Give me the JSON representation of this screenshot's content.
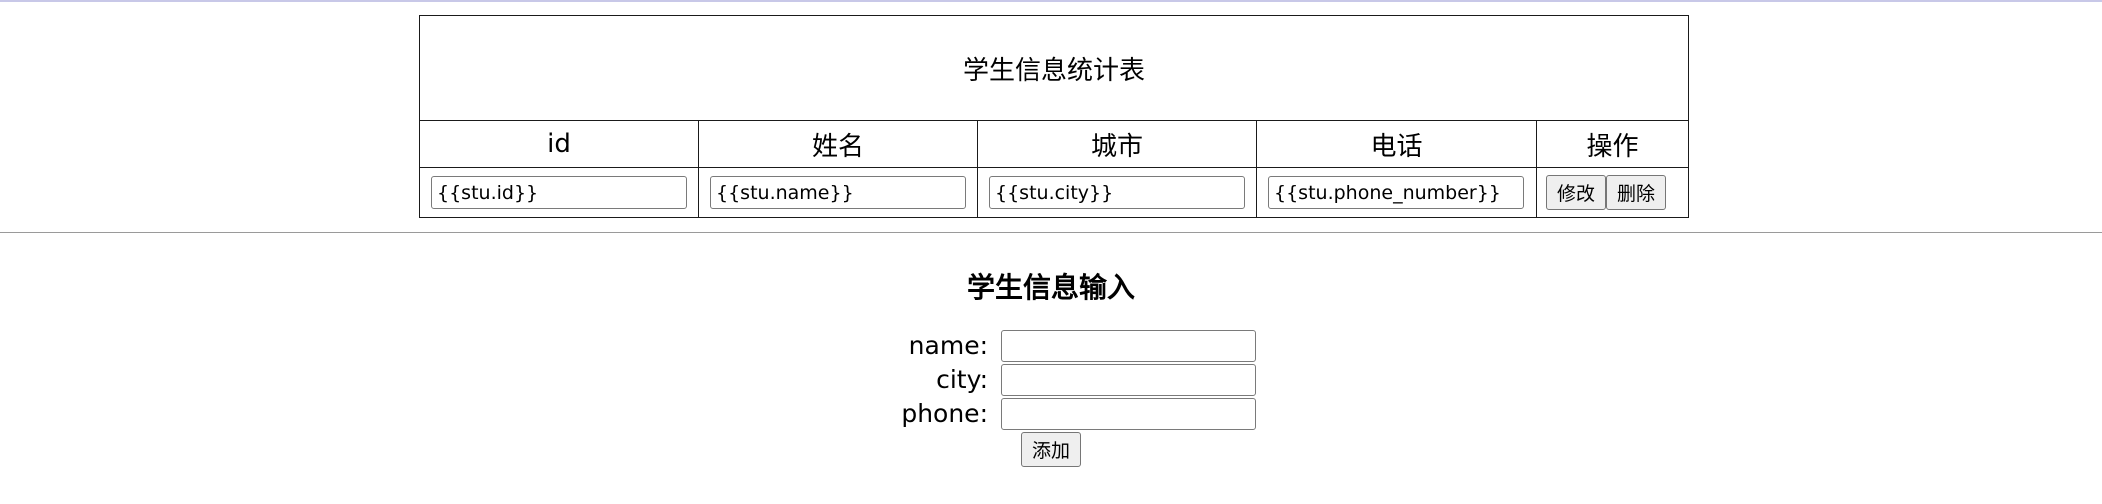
{
  "table": {
    "caption": "学生信息统计表",
    "headers": {
      "id": "id",
      "name": "姓名",
      "city": "城市",
      "phone": "电话",
      "ops": "操作"
    },
    "row": {
      "id_value": "{{stu.id}}",
      "name_value": "{{stu.name}}",
      "city_value": "{{stu.city}}",
      "phone_value": "{{stu.phone_number}}",
      "edit_label": "修改",
      "delete_label": "删除"
    }
  },
  "form": {
    "title": "学生信息输入",
    "name_label": "name:",
    "city_label": "city:",
    "phone_label": "phone:",
    "name_value": "",
    "city_value": "",
    "phone_value": "",
    "add_label": "添加"
  }
}
